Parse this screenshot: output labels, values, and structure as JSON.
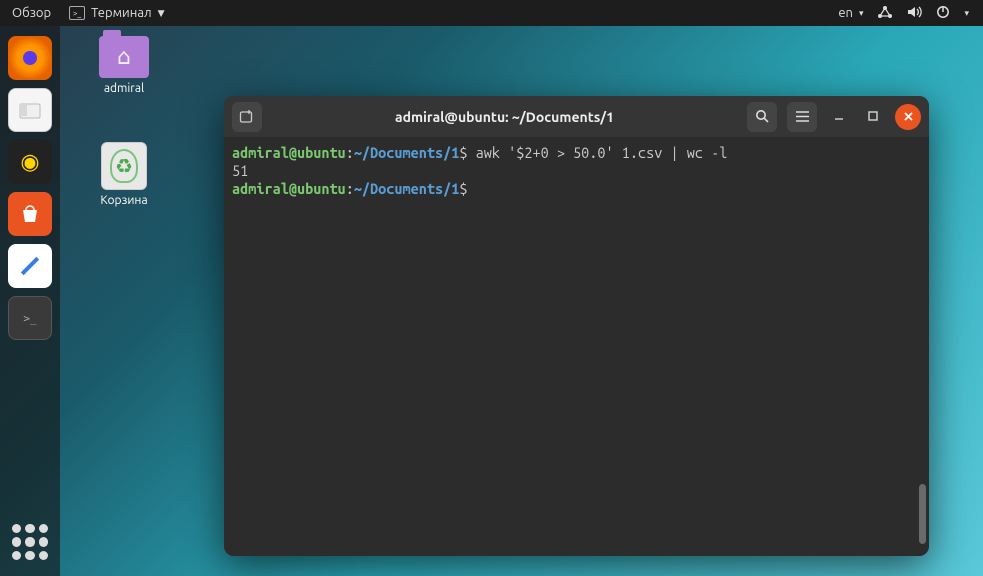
{
  "topbar": {
    "overview": "Обзор",
    "app_name": "Терминал",
    "lang": "en"
  },
  "dock": {
    "apps_tooltip": "Показать приложения"
  },
  "desktop_icons": {
    "home": "admiral",
    "trash": "Корзина"
  },
  "terminal": {
    "title": "admiral@ubuntu: ~/Documents/1",
    "prompt_user": "admiral@ubuntu",
    "prompt_sep": ":",
    "prompt_path": "~/Documents/1",
    "prompt_symbol": "$",
    "lines": [
      {
        "cmd": " awk '$2+0 > 50.0' 1.csv | wc -l"
      },
      {
        "out": "51"
      },
      {
        "cmd": " "
      }
    ]
  }
}
